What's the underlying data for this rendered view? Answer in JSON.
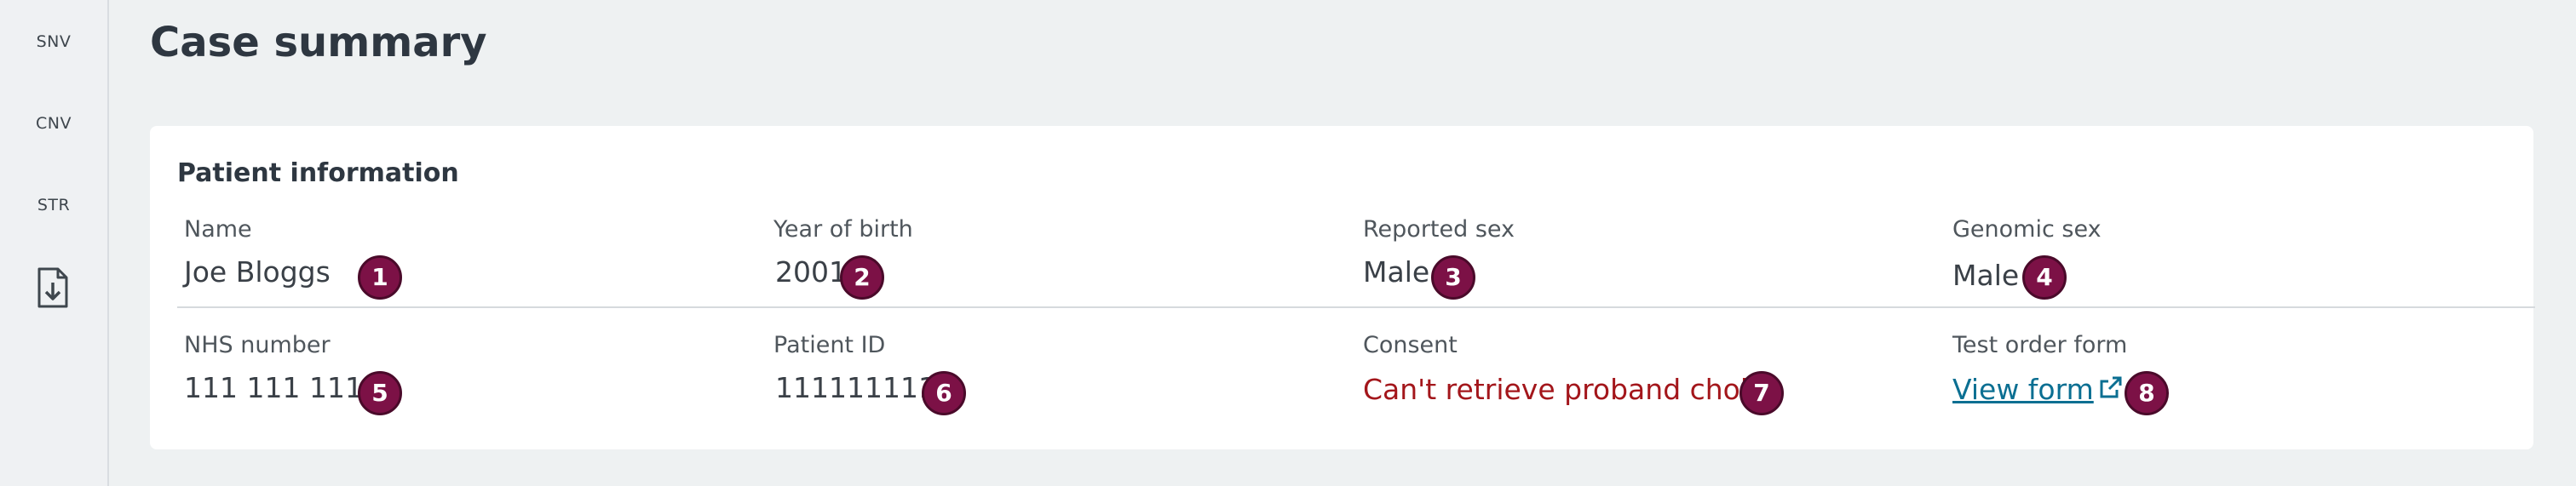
{
  "sidebar": {
    "items": [
      {
        "label": "SNV"
      },
      {
        "label": "CNV"
      },
      {
        "label": "STR"
      }
    ],
    "export_icon": "file-download-icon"
  },
  "header": {
    "title": "Case summary"
  },
  "patient_info": {
    "title": "Patient information",
    "fields": [
      {
        "label": "Name",
        "value": "Joe Bloggs",
        "badge": "1"
      },
      {
        "label": "Year of birth",
        "value": "2001",
        "badge": "2"
      },
      {
        "label": "Reported sex",
        "value": "Male",
        "badge": "3"
      },
      {
        "label": "Genomic sex",
        "value": "Male",
        "badge": "4"
      },
      {
        "label": "NHS number",
        "value": "111 111 1111",
        "badge": "5"
      },
      {
        "label": "Patient ID",
        "value": "111111111",
        "badge": "6"
      },
      {
        "label": "Consent",
        "value": "Can't retrieve proband choice",
        "badge": "7"
      },
      {
        "label": "Test order form",
        "value": "View form",
        "badge": "8"
      }
    ]
  },
  "colors": {
    "badge": "#7c1146",
    "warning_text": "#a3161b",
    "link": "#0b6f92",
    "page_bg": "#eef1f2"
  }
}
